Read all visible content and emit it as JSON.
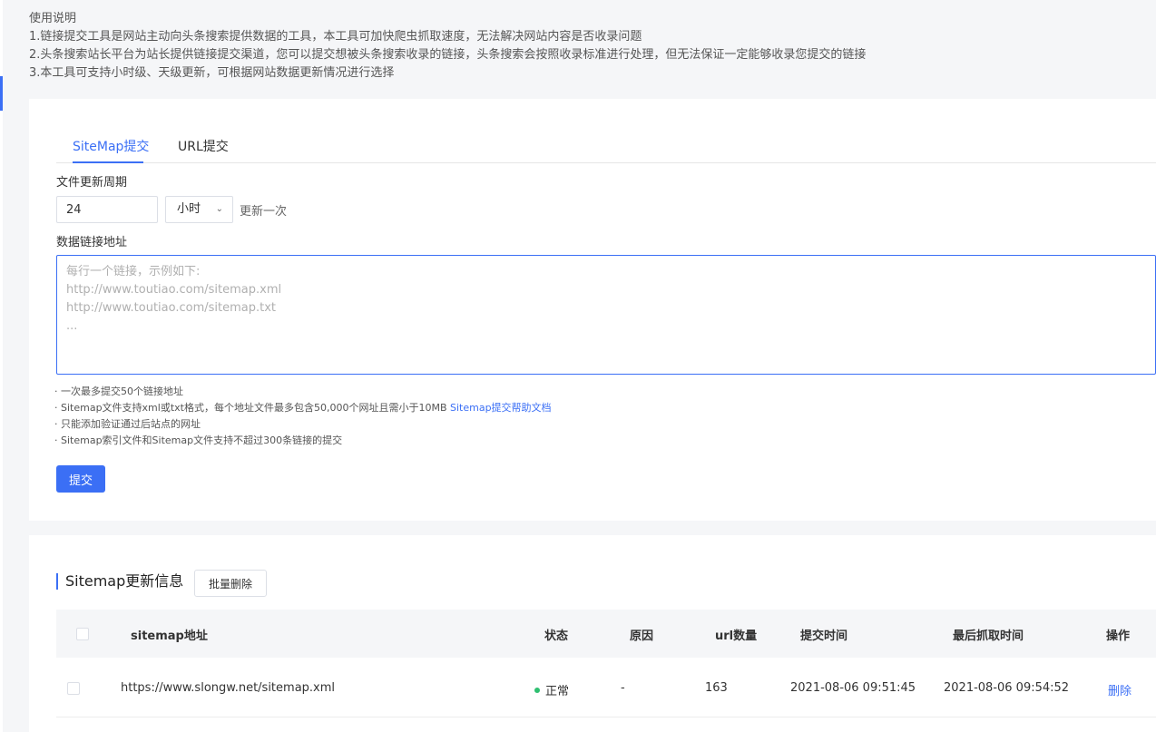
{
  "usage": {
    "title": "使用说明",
    "lines": [
      "1.链接提交工具是网站主动向头条搜索提供数据的工具，本工具可加快爬虫抓取速度，无法解决网站内容是否收录问题",
      "2.头条搜索站长平台为站长提供链接提交渠道，您可以提交想被头条搜索收录的链接，头条搜索会按照收录标准进行处理，但无法保证一定能够收录您提交的链接",
      "3.本工具可支持小时级、天级更新，可根据网站数据更新情况进行选择"
    ]
  },
  "tabs": [
    {
      "label": "SiteMap提交"
    },
    {
      "label": "URL提交"
    }
  ],
  "form": {
    "period_label": "文件更新周期",
    "period_value": "24",
    "unit_value": "小时",
    "update_once": "更新一次",
    "links_label": "数据链接地址",
    "links_placeholder": "每行一个链接，示例如下:\nhttp://www.toutiao.com/sitemap.xml\nhttp://www.toutiao.com/sitemap.txt\n...",
    "notes": [
      "· 一次最多提交50个链接地址",
      "· Sitemap文件支持xml或txt格式，每个地址文件最多包含50,000个网址且需小于10MB ",
      "· 只能添加验证通过后站点的网址",
      "· Sitemap索引文件和Sitemap文件支持不超过300条链接的提交"
    ],
    "help_link": "Sitemap提交帮助文档",
    "submit_label": "提交"
  },
  "sitemap_section": {
    "title": "Sitemap更新信息",
    "batch_delete_label": "批量删除",
    "columns": [
      "sitemap地址",
      "状态",
      "原因",
      "url数量",
      "提交时间",
      "最后抓取时间",
      "操作"
    ],
    "rows": [
      {
        "url": "https://www.slongw.net/sitemap.xml",
        "status": "正常",
        "reason": "-",
        "url_count": "163",
        "submit_time": "2021-08-06 09:51:45",
        "last_crawl_time": "2021-08-06 09:54:52",
        "action": "删除"
      }
    ]
  },
  "colors": {
    "accent": "#3b6ff5",
    "status_ok": "#2fbf71",
    "page_bg": "#f5f6f8"
  }
}
